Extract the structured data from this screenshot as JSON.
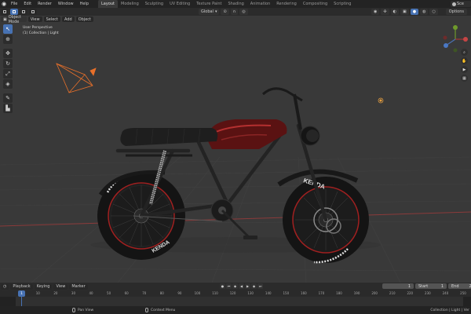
{
  "topbar": {
    "menu": [
      "File",
      "Edit",
      "Render",
      "Window",
      "Help"
    ],
    "workspaces": [
      "Layout",
      "Modeling",
      "Sculpting",
      "UV Editing",
      "Texture Paint",
      "Shading",
      "Animation",
      "Rendering",
      "Compositing",
      "Scripting"
    ],
    "active_workspace": "Layout",
    "scene_label": "Sce"
  },
  "header": {
    "mode": "Object Mode",
    "view": "View",
    "select": "Select",
    "add": "Add",
    "object": "Object",
    "orientation": "Global",
    "options": "Options"
  },
  "viewport": {
    "perspective": "User Perspective",
    "collection": "(1) Collection | Light",
    "brand_text": "KENDA",
    "colors": {
      "background": "#393939",
      "grid": "#414141",
      "axis_red": "#8b3a3a",
      "axis_green": "#5b7d2c"
    }
  },
  "timeline": {
    "playback": "Playback",
    "keying": "Keying",
    "view": "View",
    "marker": "Marker",
    "current_frame": "1",
    "start_label": "Start",
    "start_value": "1",
    "end_label": "End",
    "end_value": "250",
    "ruler_ticks": [
      "1",
      "10",
      "20",
      "30",
      "40",
      "50",
      "60",
      "70",
      "80",
      "90",
      "100",
      "110",
      "120",
      "130",
      "140",
      "150",
      "160",
      "170",
      "180",
      "190",
      "200",
      "210",
      "220",
      "230",
      "240",
      "250"
    ]
  },
  "status": {
    "left": "Pan View",
    "middle": "Context Menu",
    "right": "Collection | Light | Ver"
  }
}
